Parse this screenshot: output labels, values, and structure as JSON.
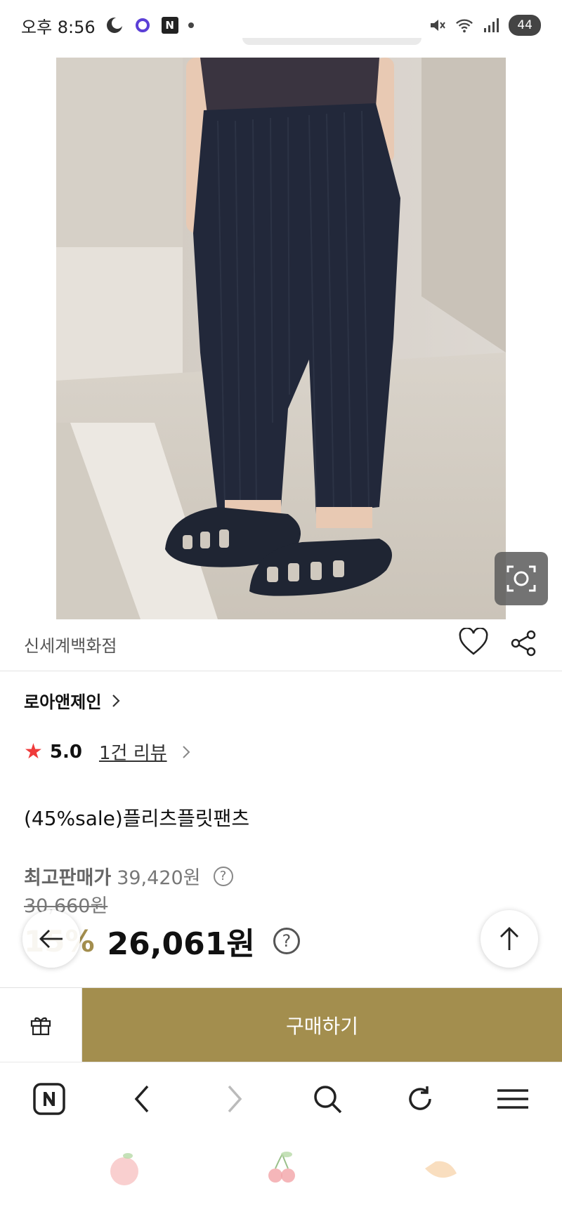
{
  "status_bar": {
    "time": "오후 8:56",
    "battery": "44"
  },
  "product": {
    "store": "신세계백화점",
    "brand": "로아앤제인",
    "rating": "5.0",
    "review_link": "1건 리뷰",
    "title": "(45%sale)플리츠플릿팬츠",
    "max_price_label": "최고판매가",
    "max_price": "39,420원",
    "original_price": "30,660원",
    "discount": "15%",
    "sale_price": "26,061원"
  },
  "actions": {
    "buy_label": "구매하기"
  },
  "icons": {
    "back": "arrow-left-icon",
    "camera": "camera-search-icon",
    "heart": "heart-icon",
    "share": "share-icon",
    "scroll_top": "arrow-up-icon",
    "gift": "gift-icon",
    "naver": "naver-n-icon",
    "nav_back": "chevron-left-icon",
    "nav_forward": "chevron-right-icon",
    "search": "search-icon",
    "refresh": "refresh-icon",
    "menu": "menu-icon"
  },
  "colors": {
    "accent": "#a38e4e",
    "star": "#ef3b3b"
  }
}
